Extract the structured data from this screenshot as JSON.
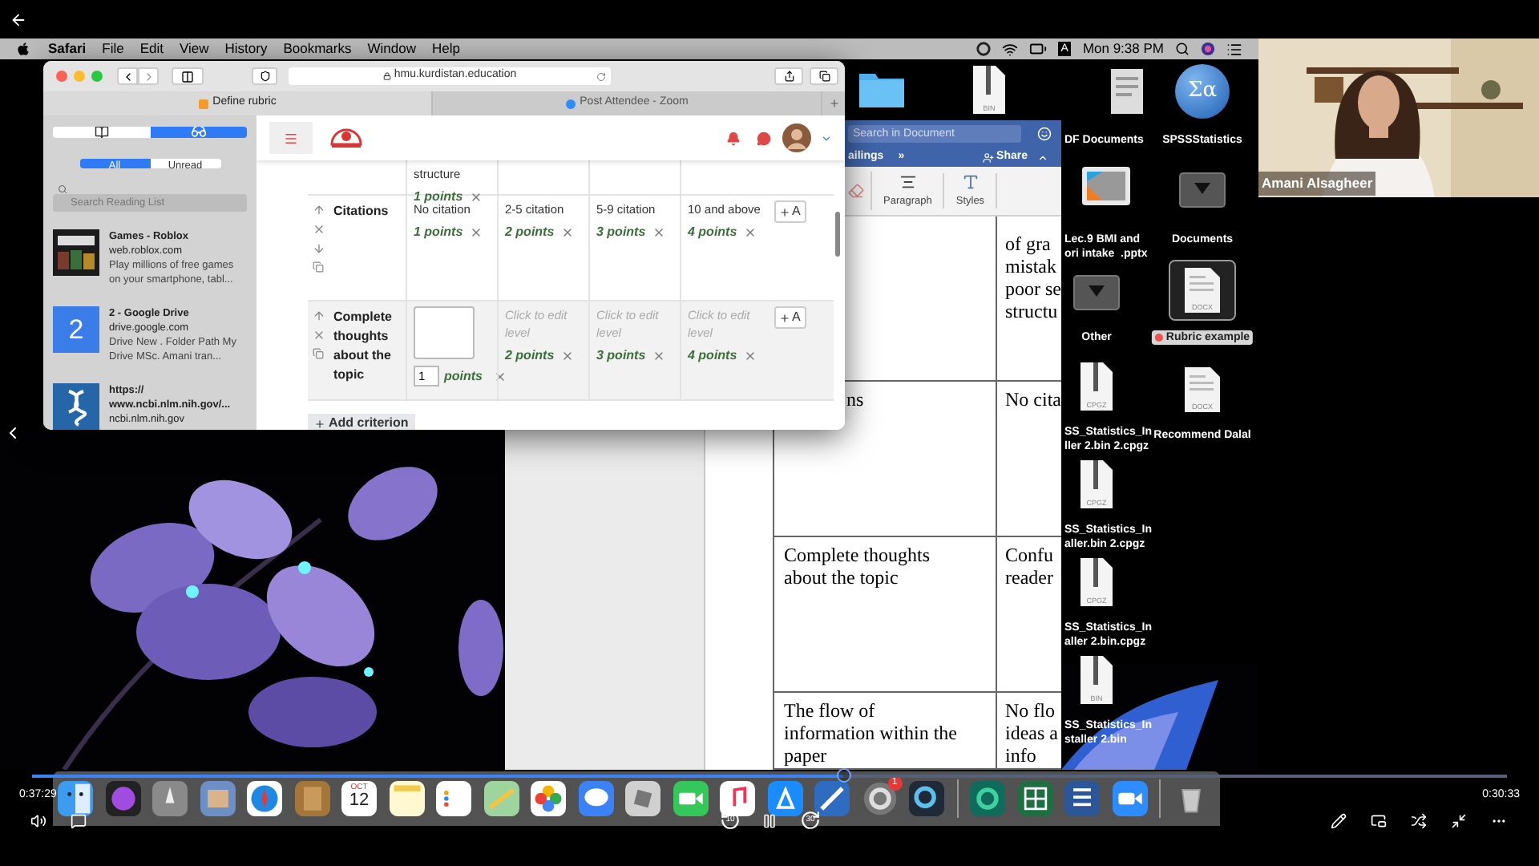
{
  "player": {
    "elapsed": "0:37:29",
    "remaining": "0:30:33",
    "progress": {
      "level": 0.55
    },
    "skip_back": "10",
    "skip_forward": "30"
  },
  "menu_bar": {
    "items": [
      "Safari",
      "File",
      "Edit",
      "View",
      "History",
      "Bookmarks",
      "Window",
      "Help"
    ],
    "input_source": "A",
    "clock": "Mon 9:38 PM"
  },
  "safari": {
    "url": "hmu.kurdistan.education",
    "tabs": [
      {
        "label": "Define rubric",
        "selected": true
      },
      {
        "label": "Post Attendee - Zoom",
        "selected": false
      }
    ],
    "sidebar": {
      "views": [
        {
          "kind": "bookmarks",
          "selected": false
        },
        {
          "kind": "reading_list",
          "selected": true
        }
      ],
      "filters": [
        {
          "label": "All",
          "selected": true
        },
        {
          "label": "Unread",
          "selected": false
        }
      ],
      "search": {
        "placeholder": "Search Reading List"
      },
      "items": [
        {
          "kind": "picture",
          "title": "Games - Roblox",
          "site": "web.roblox.com",
          "summary": "Play millions of free games on your smartphone, tabl..."
        },
        {
          "kind": "tile",
          "tile_text": "2",
          "title": "2 - Google Drive",
          "site": "drive.google.com",
          "summary": "Drive New . Folder Path My Drive MSc. Amani tran..."
        },
        {
          "kind": "icon",
          "title": "https:// www.ncbi.nlm.nih.gov/...",
          "site": "ncbi.nlm.nih.gov"
        }
      ]
    },
    "rubric": {
      "criteria": [
        {
          "kind": "cut",
          "levels": [
            {
              "kind": "text",
              "definition": "structure",
              "points": "1 points"
            },
            {
              "kind": "blank"
            },
            {
              "kind": "blank"
            },
            {
              "kind": "blank"
            }
          ]
        },
        {
          "kind": "full",
          "name": "Citations",
          "add_level": "A",
          "levels": [
            {
              "kind": "text",
              "definition": "No citation",
              "points": "1 points"
            },
            {
              "kind": "text",
              "definition": "2-5 citation",
              "points": "2 points"
            },
            {
              "kind": "text",
              "definition": "5-9 citation",
              "points": "3 points"
            },
            {
              "kind": "text",
              "definition": "10 and above",
              "points": "4 points"
            }
          ]
        },
        {
          "kind": "full",
          "name": "Complete thoughts about the topic",
          "add_level": "A",
          "levels": [
            {
              "kind": "editing",
              "value": "1",
              "unit": "points"
            },
            {
              "kind": "hint",
              "hint": "Click to edit level",
              "points": "2 points"
            },
            {
              "kind": "hint",
              "hint": "Click to edit level",
              "points": "3 points"
            },
            {
              "kind": "hint",
              "hint": "Click to edit level",
              "points": "4 points"
            }
          ]
        }
      ],
      "add_criterion": "Add criterion"
    }
  },
  "word": {
    "search": {
      "placeholder": "Search in Document"
    },
    "tab": "ailings",
    "more": "»",
    "share": "Share",
    "groups": [
      "Paragraph",
      "Styles"
    ],
    "rows": [
      {
        "col_2": "of gra\nmistak\npoor se\nstructu"
      },
      {
        "col_1": "ns",
        "col_2": "No cita"
      },
      {
        "col_1": "Complete thoughts\nabout the topic",
        "col_2": "Confu\nreader"
      },
      {
        "col_1": "The flow of\ninformation within the\npaper",
        "col_2": "No flo\nideas a\ninfo"
      }
    ]
  },
  "desktop": {
    "icons": [
      {
        "kind": "folder",
        "selected": false
      },
      {
        "kind": "file",
        "type": "BIN",
        "selected": false
      },
      {
        "kind": "document",
        "label": "DF Documents",
        "selected": false
      },
      {
        "kind": "spss",
        "symbol": "Σα",
        "label": "SPSSStatistics",
        "selected": false
      },
      {
        "kind": "slides",
        "label": "Lec.9 BMI and\nori intake  .pptx",
        "selected": false
      },
      {
        "kind": "stack",
        "label": "Documents",
        "selected": false
      },
      {
        "kind": "stack",
        "label": "Other",
        "selected": false
      },
      {
        "kind": "docx",
        "type": "DOCX",
        "label": "Rubric example",
        "selected": true,
        "color": "#f0524a"
      },
      {
        "kind": "file",
        "type": "CPGZ",
        "label": "SS_Statistics_In\nller 2.bin 2.cpgz",
        "selected": false
      },
      {
        "kind": "docx",
        "type": "DOCX",
        "label": "Recommend Dalal",
        "selected": false
      },
      {
        "kind": "file",
        "type": "CPGZ",
        "label": "SS_Statistics_In\naller.bin 2.cpgz",
        "selected": false
      },
      {
        "kind": "file",
        "type": "CPGZ",
        "label": "SS_Statistics_In\naller 2.bin.cpgz",
        "selected": false
      },
      {
        "kind": "file",
        "type": "BIN",
        "label": "SS_Statistics_In\nstaller 2.bin",
        "selected": false
      }
    ]
  },
  "dock": {
    "calendar_month": "OCT",
    "calendar_day": "12",
    "badge": "1"
  },
  "webcam": {
    "name": "Amani Alsagheer"
  }
}
